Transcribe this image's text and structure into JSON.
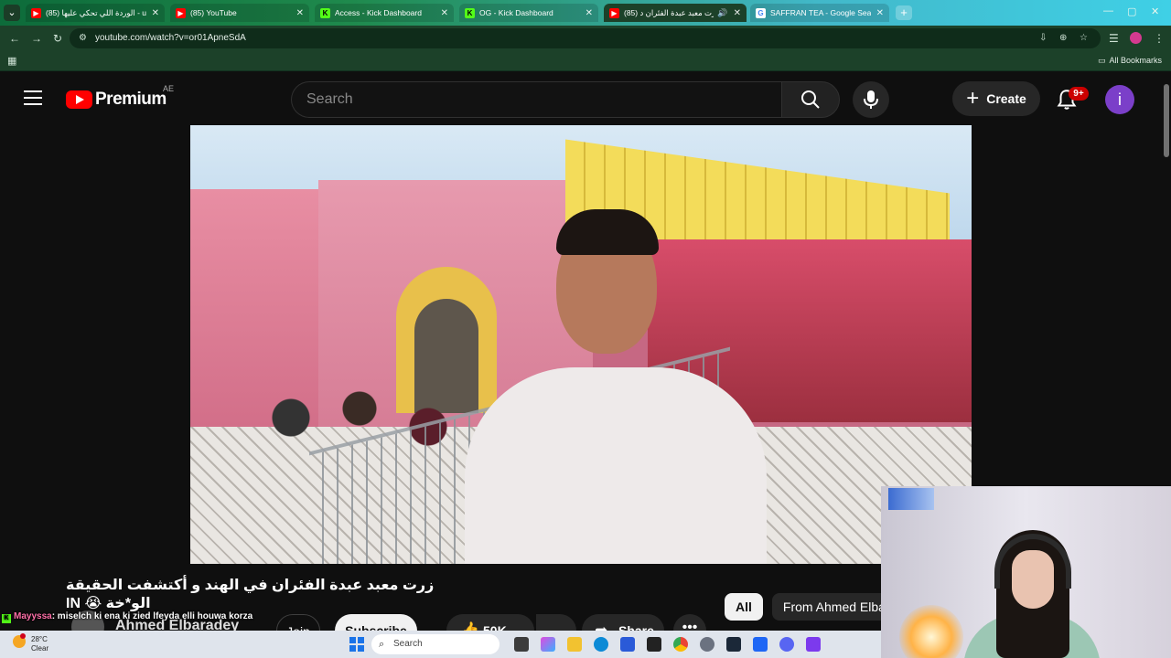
{
  "browser": {
    "tabs": [
      {
        "title": "(85) الوردة اللي تحكي عليها - ube",
        "favicon": "youtube-icon",
        "active": false
      },
      {
        "title": "(85) YouTube",
        "favicon": "youtube-icon",
        "active": false
      },
      {
        "title": "Access - Kick Dashboard",
        "favicon": "kick-icon",
        "active": false
      },
      {
        "title": "OG - Kick Dashboard",
        "favicon": "kick-icon",
        "active": false
      },
      {
        "title": "(85) زرت معبد عبدة الفئران د",
        "favicon": "youtube-icon",
        "active": true
      },
      {
        "title": "SAFFRAN TEA - Google Search",
        "favicon": "google-icon",
        "active": false
      }
    ],
    "new_tab_label": "+",
    "url": "youtube.com/watch?v=or01ApneSdA",
    "bookmarks": {
      "all_label": "All Bookmarks"
    }
  },
  "youtube": {
    "brand": "Premium",
    "region": "AE",
    "search_placeholder": "Search",
    "create_label": "Create",
    "notifications": "9+",
    "avatar_letter": "i"
  },
  "video": {
    "title": "زرت معبد عبدة الفئران في الهند و أكتشفت الحقيقة الو*خة 😭 IN",
    "channel": "Ahmed Elbaradey",
    "join_label": "Join",
    "subscribe_label": "Subscribe",
    "likes": "50K",
    "share_label": "Share",
    "more_label": "•••"
  },
  "chips": [
    {
      "label": "All",
      "selected": true
    },
    {
      "label": "From Ahmed Elba",
      "selected": false
    }
  ],
  "chat": {
    "user": "Mayyssa",
    "message": ": miselch ki ena ki zied lfeyda elli houwa korza"
  },
  "taskbar": {
    "temp": "28°C",
    "condition": "Clear",
    "search_placeholder": "Search"
  },
  "colors": {
    "tab_strip": "#1f8a4d",
    "youtube_red": "#ff0000",
    "kick_green": "#53fc18",
    "avatar_purple": "#7b3fc9"
  }
}
